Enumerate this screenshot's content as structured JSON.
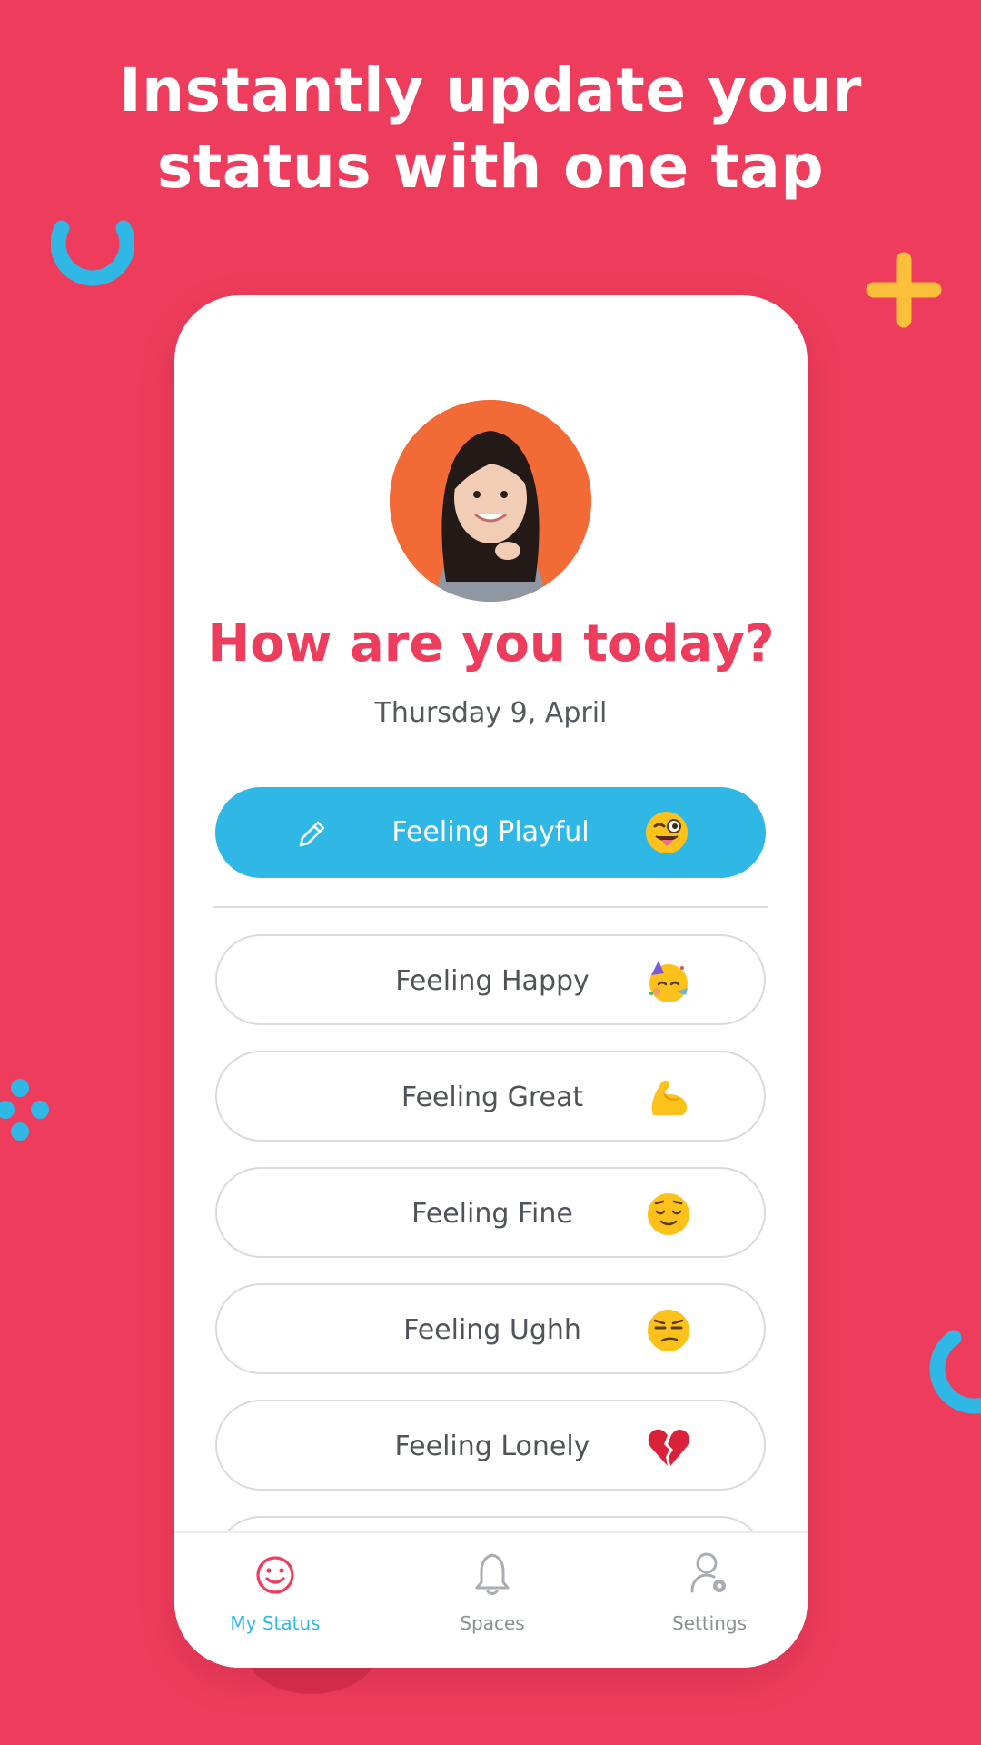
{
  "headline": {
    "line1": "Instantly update your",
    "line2": "status with one tap"
  },
  "profile": {
    "avatar_icon": "profile-photo",
    "question": "How are you today?",
    "date": "Thursday 9, April"
  },
  "current_status": {
    "label": "Feeling Playful",
    "emoji": "😜",
    "edit_icon": "pencil-icon"
  },
  "options": [
    {
      "label": "Feeling Happy",
      "emoji": "🥳"
    },
    {
      "label": "Feeling Great",
      "emoji": "💪"
    },
    {
      "label": "Feeling Fine",
      "emoji": "😌"
    },
    {
      "label": "Feeling Ughh",
      "emoji": "😒"
    },
    {
      "label": "Feeling Lonely",
      "emoji": "💔"
    }
  ],
  "tabbar": {
    "tabs": [
      {
        "label": "My Status",
        "icon": "smile-icon",
        "active": true
      },
      {
        "label": "Spaces",
        "icon": "bell-icon",
        "active": false
      },
      {
        "label": "Settings",
        "icon": "user-gear-icon",
        "active": false
      }
    ]
  },
  "colors": {
    "background": "#ee3d5c",
    "accent_blue": "#2fb8e6",
    "accent_yellow": "#fcbf3a",
    "title_red": "#ee3d5c"
  }
}
